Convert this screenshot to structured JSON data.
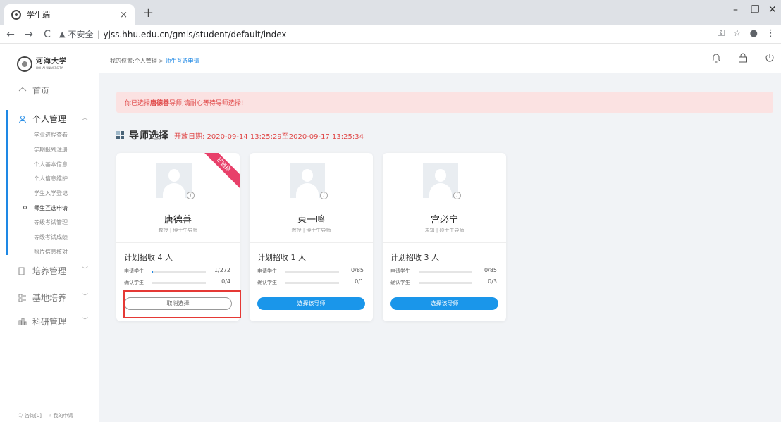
{
  "browser": {
    "tab_title": "学生端",
    "tab_close": "×",
    "new_tab": "+",
    "nav_back": "←",
    "nav_forward": "→",
    "nav_reload": "C",
    "insecure_label": "不安全",
    "url": "yjss.hhu.edu.cn/gmis/student/default/index",
    "win_minimize": "–",
    "win_restore": "❐",
    "win_close": "✕",
    "key_icon": "⚿",
    "star_icon": "☆",
    "profile_icon": "●",
    "menu_icon": "⋮"
  },
  "logo": {
    "name_cn": "河海大学",
    "name_en": "HOHAI UNIVERSITY"
  },
  "sidebar": {
    "items": [
      {
        "label": "首页",
        "icon": "home-icon"
      },
      {
        "label": "个人管理",
        "icon": "user-icon",
        "expanded": true
      },
      {
        "label": "培养管理",
        "icon": "training-icon"
      },
      {
        "label": "基地培养",
        "icon": "base-icon"
      },
      {
        "label": "科研管理",
        "icon": "research-icon"
      }
    ],
    "sub_items": [
      "学业进程查看",
      "学期报到注册",
      "个人基本信息",
      "个人信息维护",
      "学生入学登记",
      "师生互选申请",
      "等级考试管理",
      "等级考试成绩",
      "照片信息核对"
    ],
    "active_sub": "师生互选申请",
    "footer_consult": "咨询[0]",
    "footer_apply": "我的申请"
  },
  "header": {
    "breadcrumb_prefix": "我的位置:个人管理 > ",
    "breadcrumb_current": "师生互选申请",
    "icons": [
      "bell-icon",
      "lock-icon",
      "power-icon"
    ]
  },
  "alert": {
    "prefix": "你已选择",
    "teacher": "唐德善",
    "suffix": "导师,请耐心等待导师选择!"
  },
  "section": {
    "title": "导师选择",
    "date_text": "开放日期: 2020-09-14 13:25:29至2020-09-17 13:25:34"
  },
  "cards": [
    {
      "name": "唐德善",
      "title": "教授",
      "sep": "|",
      "role": "博士生导师",
      "plan": "计划招收 4 人",
      "applied_label": "申请学生",
      "applied": "1/272",
      "applied_fraction": 0.004,
      "confirmed_label": "确认学生",
      "confirmed": "0/4",
      "confirmed_fraction": 0,
      "button": "取消选择",
      "button_style": "outline",
      "selected_badge": "已选择"
    },
    {
      "name": "束一鸣",
      "title": "教授",
      "sep": "|",
      "role": "博士生导师",
      "plan": "计划招收 1 人",
      "applied_label": "申请学生",
      "applied": "0/85",
      "applied_fraction": 0,
      "confirmed_label": "确认学生",
      "confirmed": "0/1",
      "confirmed_fraction": 0,
      "button": "选择该导师",
      "button_style": "primary"
    },
    {
      "name": "宫必宁",
      "title": "未知",
      "sep": "|",
      "role": "硕士生导师",
      "plan": "计划招收 3 人",
      "applied_label": "申请学生",
      "applied": "0/85",
      "applied_fraction": 0,
      "confirmed_label": "确认学生",
      "confirmed": "0/3",
      "confirmed_fraction": 0,
      "button": "选择该导师",
      "button_style": "primary"
    }
  ],
  "colors": {
    "accent": "#1e88e5",
    "alert_bg": "#fbe2e2",
    "alert_text": "#e04848",
    "ribbon": "#e8406a",
    "highlight": "#e53935"
  }
}
